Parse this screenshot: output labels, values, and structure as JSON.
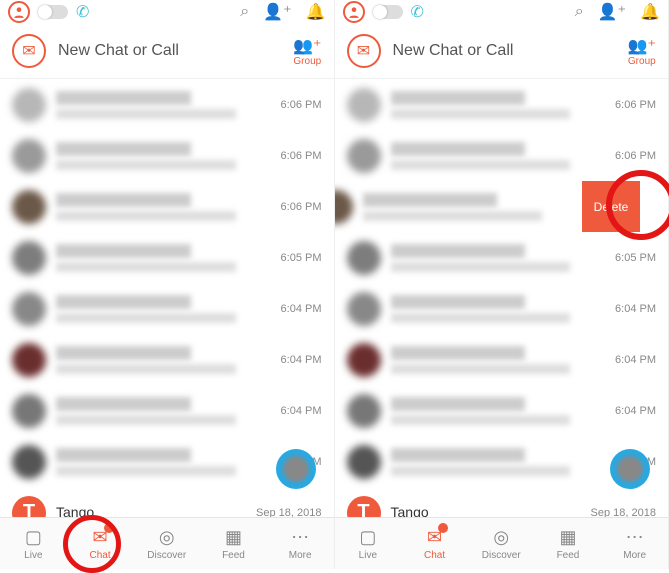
{
  "topbar": {
    "search": "",
    "addfriend": "",
    "bell": ""
  },
  "newchat": {
    "label": "New Chat or Call",
    "group": "Group"
  },
  "chats": [
    {
      "time": "6:06 PM",
      "color": "#b7b7b7"
    },
    {
      "time": "6:06 PM",
      "color": "#9a9a9a"
    },
    {
      "time": "6:06 PM",
      "color": "#6b5848"
    },
    {
      "time": "6:05 PM",
      "color": "#7d7d7d"
    },
    {
      "time": "6:04 PM",
      "color": "#888"
    },
    {
      "time": "6:04 PM",
      "color": "#6b2e2e"
    },
    {
      "time": "6:04 PM",
      "color": "#777"
    },
    {
      "time": "6:01 PM",
      "color": "#555"
    }
  ],
  "tango": {
    "name": "Tango",
    "date": "Sep 18, 2018",
    "letter": "T"
  },
  "swipe": {
    "delete": "Delete"
  },
  "tabs": {
    "live": "Live",
    "chat": "Chat",
    "discover": "Discover",
    "feed": "Feed",
    "more": "More"
  }
}
